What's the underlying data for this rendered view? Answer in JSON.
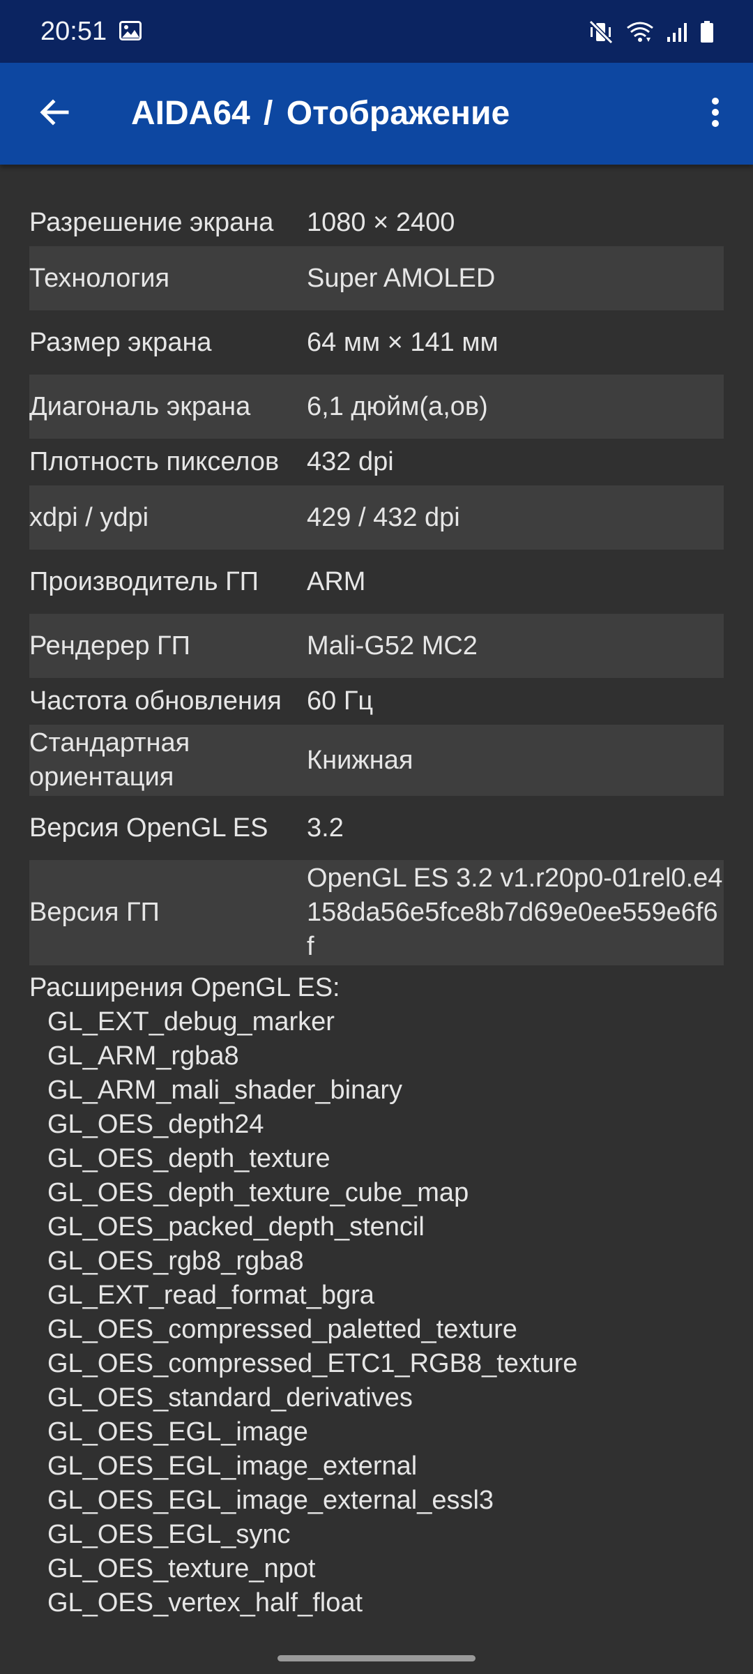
{
  "status_bar": {
    "time": "20:51",
    "icons": [
      "image-icon",
      "mute-vibrate-icon",
      "wifi-icon",
      "signal-icon",
      "battery-icon"
    ]
  },
  "app_bar": {
    "title": "AIDA64  /  Отображение",
    "back_icon": "arrow-back-icon",
    "menu_icon": "more-vert-icon"
  },
  "colors": {
    "status_bar_bg": "#0b2461",
    "app_bar_bg": "#0d47a1",
    "page_bg": "#303030",
    "row_alt_bg": "#3e3e3e",
    "text": "#e6e6e6"
  },
  "rows": [
    {
      "label": "Разрешение экрана",
      "value": "1080 × 2400"
    },
    {
      "label": "Технология",
      "value": "Super AMOLED"
    },
    {
      "label": "Размер экрана",
      "value": "64 мм × 141 мм"
    },
    {
      "label": "Диагональ экрана",
      "value": "6,1 дюйм(а,ов)"
    },
    {
      "label": "Плотность пикселов",
      "value": "432 dpi"
    },
    {
      "label": "xdpi / ydpi",
      "value": "429 / 432 dpi"
    },
    {
      "label": "Производитель ГП",
      "value": "ARM"
    },
    {
      "label": "Рендерер ГП",
      "value": "Mali-G52 MC2"
    },
    {
      "label": "Частота обновления",
      "value": "60 Гц"
    },
    {
      "label": "Стандартная ориентация",
      "value": "Книжная"
    },
    {
      "label": "Версия OpenGL ES",
      "value": "3.2"
    },
    {
      "label": "Версия ГП",
      "value": "OpenGL ES 3.2 v1.r20p0-01rel0.e4158da56e5fce8b7d69e0ee559e6f6f"
    }
  ],
  "extensions": {
    "title": "Расширения OpenGL ES:",
    "items": [
      "GL_EXT_debug_marker",
      "GL_ARM_rgba8",
      "GL_ARM_mali_shader_binary",
      "GL_OES_depth24",
      "GL_OES_depth_texture",
      "GL_OES_depth_texture_cube_map",
      "GL_OES_packed_depth_stencil",
      "GL_OES_rgb8_rgba8",
      "GL_EXT_read_format_bgra",
      "GL_OES_compressed_paletted_texture",
      "GL_OES_compressed_ETC1_RGB8_texture",
      "GL_OES_standard_derivatives",
      "GL_OES_EGL_image",
      "GL_OES_EGL_image_external",
      "GL_OES_EGL_image_external_essl3",
      "GL_OES_EGL_sync",
      "GL_OES_texture_npot",
      "GL_OES_vertex_half_float"
    ]
  }
}
